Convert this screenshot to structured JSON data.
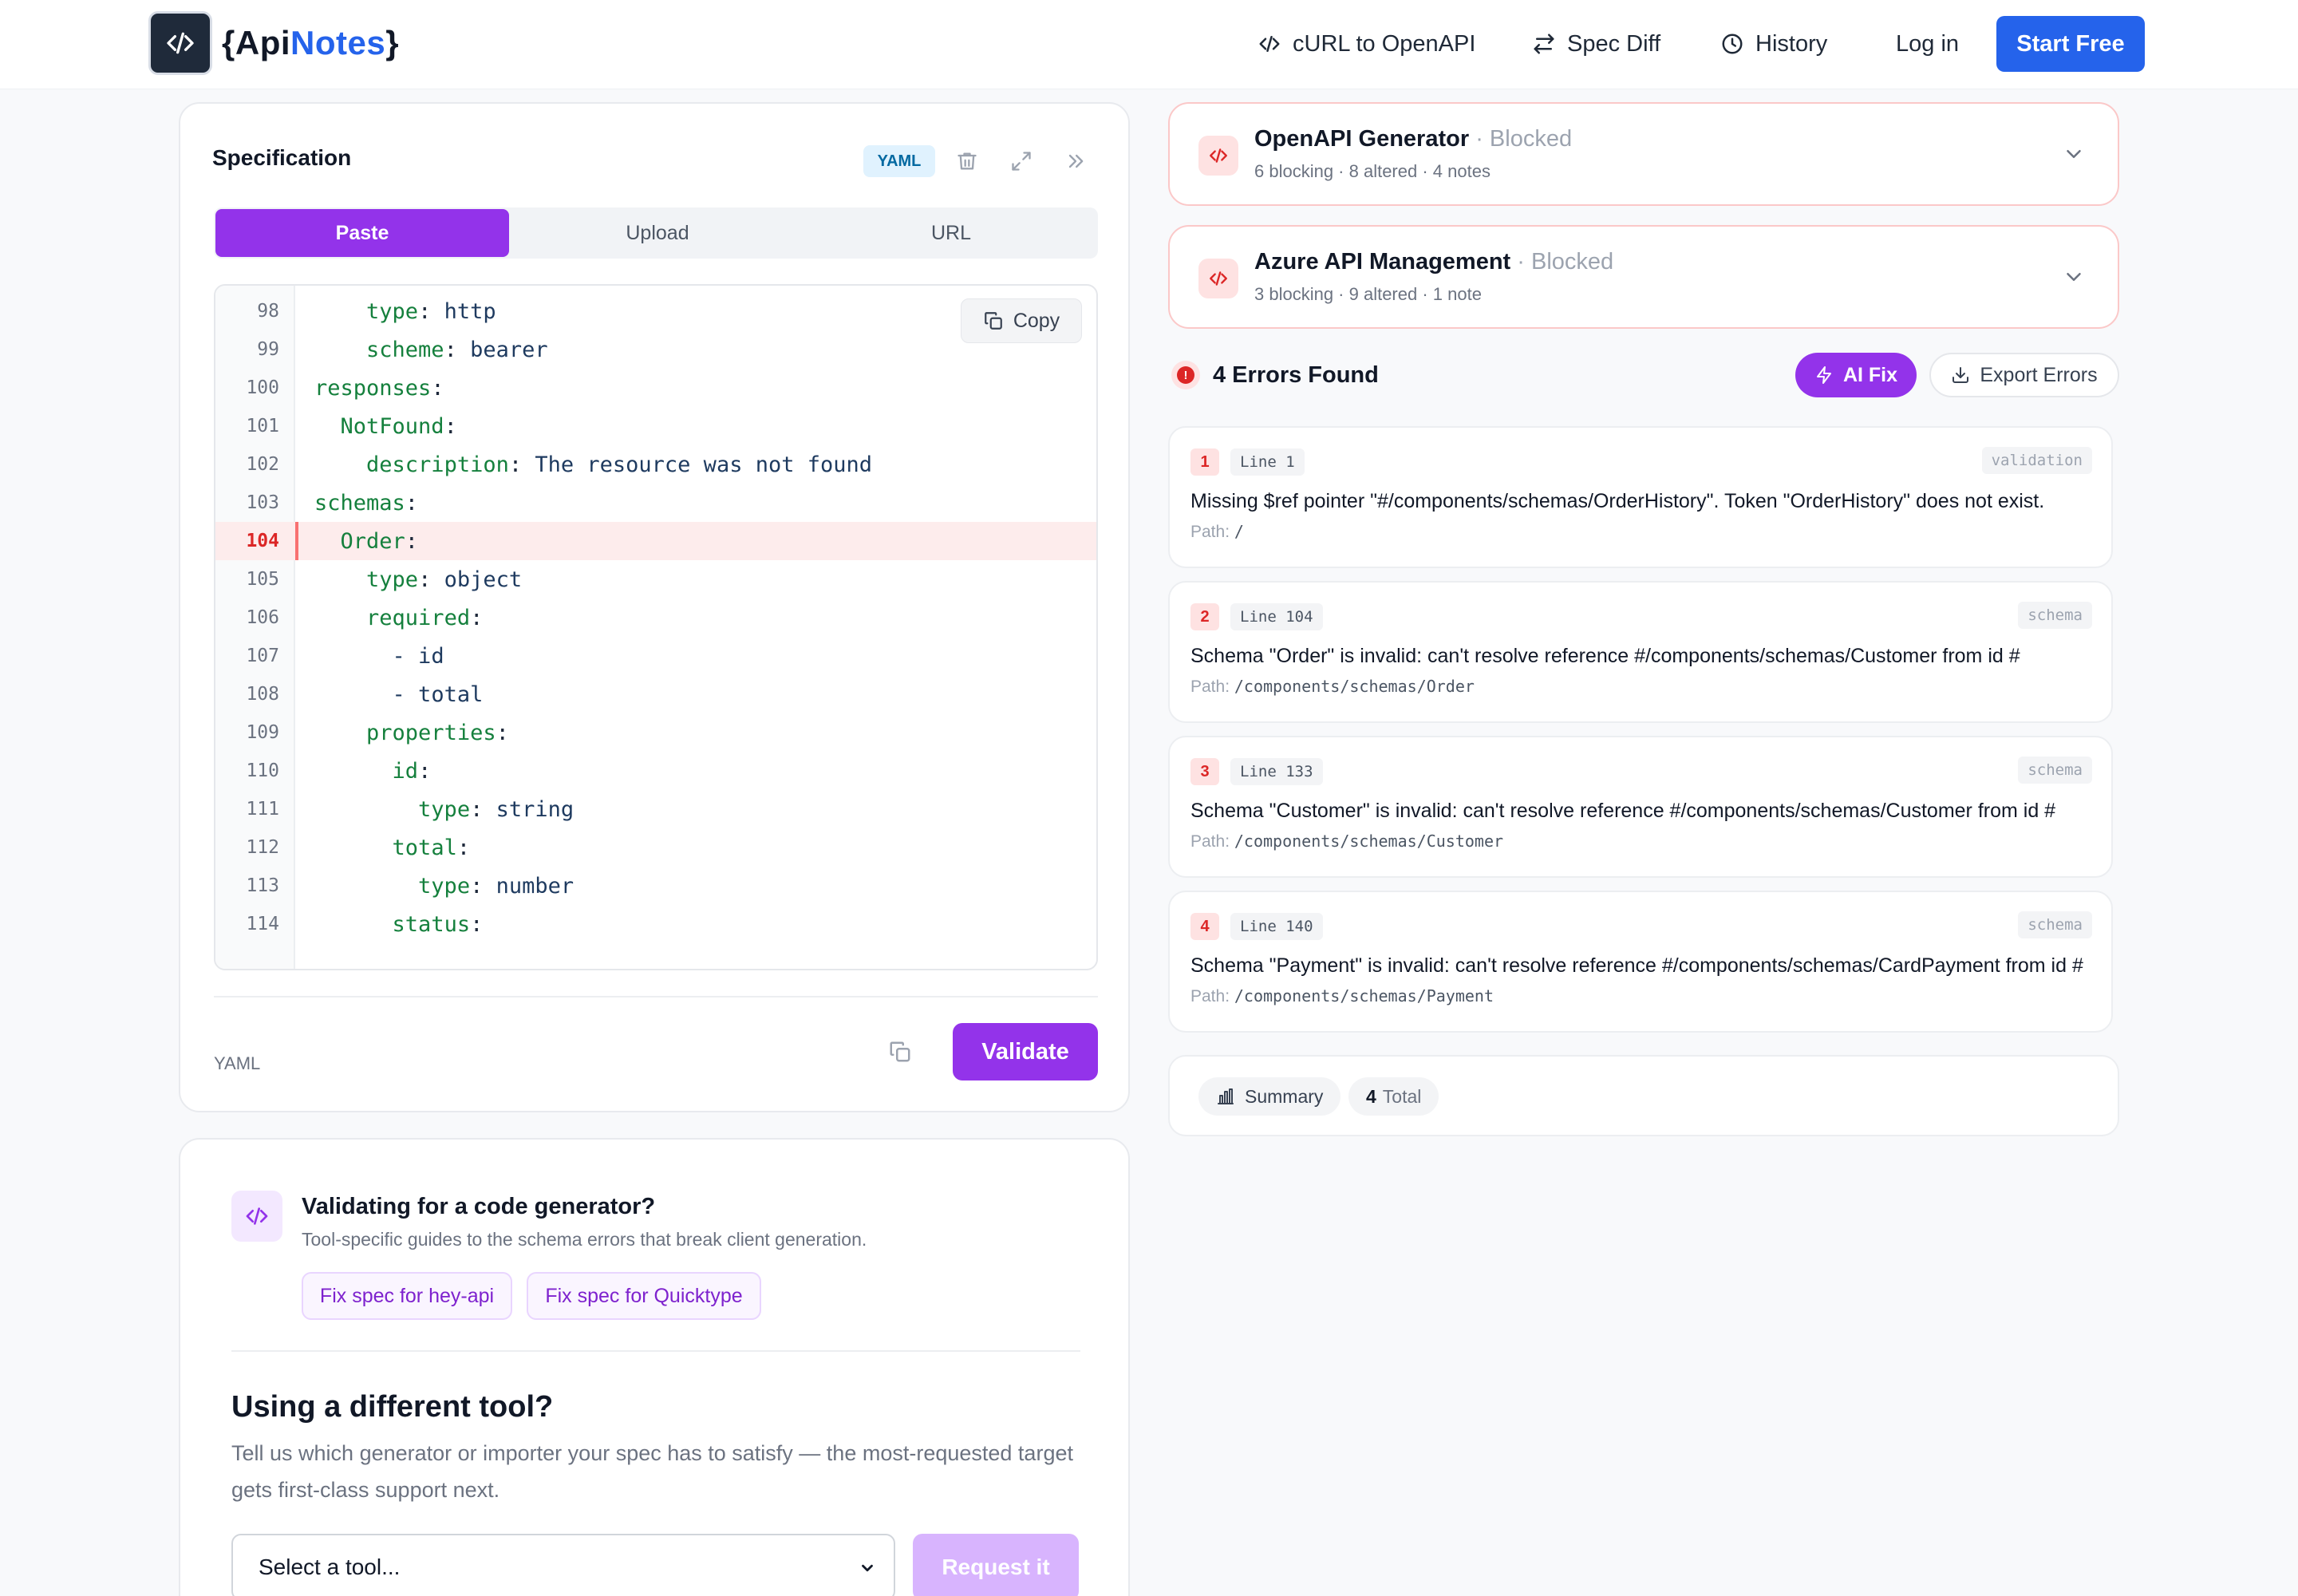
{
  "header": {
    "logo_open": "{",
    "logo_api": "Api",
    "logo_notes": "Notes",
    "logo_close": "}",
    "nav": [
      {
        "label": "cURL to OpenAPI",
        "icon": "code-icon"
      },
      {
        "label": "Spec Diff",
        "icon": "swap-icon"
      },
      {
        "label": "History",
        "icon": "clock-icon"
      },
      {
        "label": "Log in"
      }
    ],
    "cta": "Start Free"
  },
  "spec": {
    "title": "Specification",
    "format_badge": "YAML",
    "tabs": [
      "Paste",
      "Upload",
      "URL"
    ],
    "active_tab": "Paste",
    "copy_label": "Copy",
    "error_line": "104",
    "lines": [
      {
        "n": "98",
        "indent": "    ",
        "key": "type",
        "val": " http"
      },
      {
        "n": "99",
        "indent": "    ",
        "key": "scheme",
        "val": " bearer"
      },
      {
        "n": "100",
        "indent": "",
        "key": "responses",
        "val": ""
      },
      {
        "n": "101",
        "indent": "  ",
        "key": "NotFound",
        "val": ""
      },
      {
        "n": "102",
        "indent": "    ",
        "key": "description",
        "val": " The resource was not found"
      },
      {
        "n": "103",
        "indent": "",
        "key": "schemas",
        "val": ""
      },
      {
        "n": "104",
        "indent": "  ",
        "key": "Order",
        "val": ""
      },
      {
        "n": "105",
        "indent": "    ",
        "key": "type",
        "val": " object"
      },
      {
        "n": "106",
        "indent": "    ",
        "key": "required",
        "val": ""
      },
      {
        "n": "107",
        "indent": "      ",
        "key": "",
        "val": "- id"
      },
      {
        "n": "108",
        "indent": "      ",
        "key": "",
        "val": "- total"
      },
      {
        "n": "109",
        "indent": "    ",
        "key": "properties",
        "val": ""
      },
      {
        "n": "110",
        "indent": "      ",
        "key": "id",
        "val": ""
      },
      {
        "n": "111",
        "indent": "        ",
        "key": "type",
        "val": " string"
      },
      {
        "n": "112",
        "indent": "      ",
        "key": "total",
        "val": ""
      },
      {
        "n": "113",
        "indent": "        ",
        "key": "type",
        "val": " number"
      },
      {
        "n": "114",
        "indent": "      ",
        "key": "status",
        "val": ""
      }
    ],
    "footer_format": "YAML",
    "validate_label": "Validate"
  },
  "guide": {
    "title": "Validating for a code generator?",
    "subtitle": "Tool-specific guides to the schema errors that break client generation.",
    "links": [
      "Fix spec for hey-api",
      "Fix spec for Quicktype"
    ],
    "diff_title": "Using a different tool?",
    "diff_text": "Tell us which generator or importer your spec has to satisfy — the most-requested target gets first-class support next.",
    "select_value": "Select a tool...",
    "request_label": "Request it"
  },
  "generators": [
    {
      "name": "OpenAPI Generator",
      "status": "· Blocked",
      "meta": "6 blocking · 8 altered · 4 notes"
    },
    {
      "name": "Azure API Management",
      "status": "· Blocked",
      "meta": "3 blocking · 9 altered · 1 note"
    }
  ],
  "errors": {
    "icon_glyph": "!",
    "title": "4 Errors Found",
    "ai_fix": "AI Fix",
    "export": "Export Errors",
    "path_label": "Path:",
    "items": [
      {
        "num": "1",
        "line": "Line 1",
        "type": "validation",
        "message": "Missing $ref pointer \"#/components/schemas/OrderHistory\". Token \"OrderHistory\" does not exist.",
        "path": "/"
      },
      {
        "num": "2",
        "line": "Line 104",
        "type": "schema",
        "message": "Schema \"Order\" is invalid: can't resolve reference #/components/schemas/Customer from id #",
        "path": "/components/schemas/Order"
      },
      {
        "num": "3",
        "line": "Line 133",
        "type": "schema",
        "message": "Schema \"Customer\" is invalid: can't resolve reference #/components/schemas/Customer from id #",
        "path": "/components/schemas/Customer"
      },
      {
        "num": "4",
        "line": "Line 140",
        "type": "schema",
        "message": "Schema \"Payment\" is invalid: can't resolve reference #/components/schemas/CardPayment from id #",
        "path": "/components/schemas/Payment"
      }
    ]
  },
  "summary": {
    "label": "Summary",
    "total_count": "4",
    "total_label": "Total"
  },
  "colors": {
    "primary": "#2563eb",
    "purple": "#9333ea",
    "error": "#dc2626"
  }
}
